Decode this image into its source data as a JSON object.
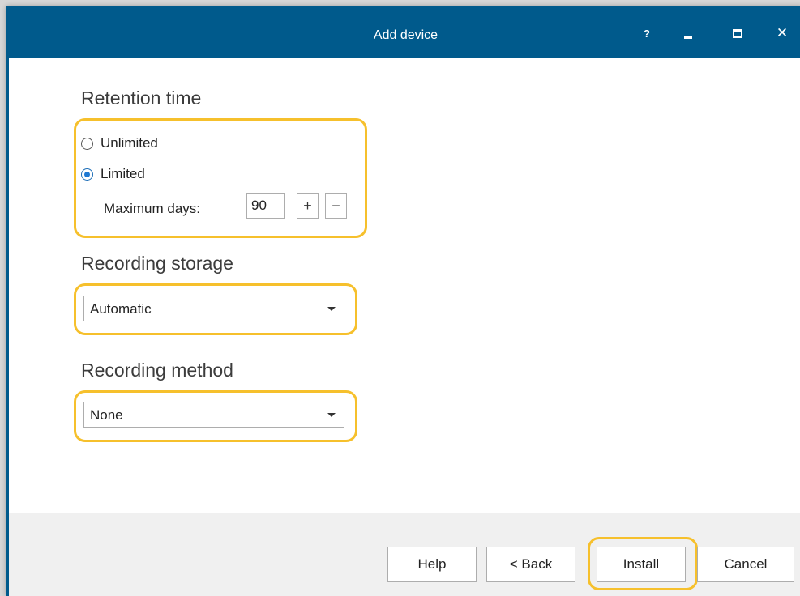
{
  "window": {
    "title": "Add device",
    "help_glyph": "?",
    "close_glyph": "✕"
  },
  "retention": {
    "heading": "Retention time",
    "options": [
      {
        "label": "Unlimited",
        "checked": false
      },
      {
        "label": "Limited",
        "checked": true
      }
    ],
    "max_days_label": "Maximum days:",
    "max_days_value": "90",
    "increment_label": "+",
    "decrement_label": "−"
  },
  "storage": {
    "heading": "Recording storage",
    "selected": "Automatic"
  },
  "method": {
    "heading": "Recording method",
    "selected": "None"
  },
  "footer": {
    "help_label": "Help",
    "back_label": "< Back",
    "install_label": "Install",
    "cancel_label": "Cancel"
  },
  "colors": {
    "titlebar": "#005a8c",
    "highlight": "#f6c02c",
    "radio_accent": "#1e78d2"
  },
  "icons": {
    "help": "question-icon",
    "minimize": "minimize-icon",
    "maximize": "maximize-icon",
    "close": "close-icon",
    "dropdown": "chevron-down-icon"
  }
}
